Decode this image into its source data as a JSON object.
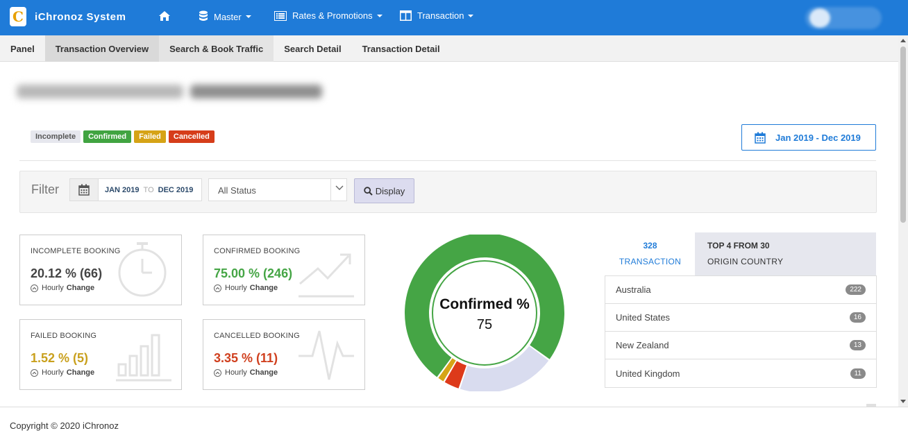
{
  "app": {
    "name": "iChronoz System",
    "logo_letter": "C"
  },
  "nav": {
    "items": [
      {
        "label": "Master",
        "icon": "database-icon"
      },
      {
        "label": "Rates & Promotions",
        "icon": "list-icon"
      },
      {
        "label": "Transaction",
        "icon": "columns-icon"
      }
    ]
  },
  "subnav": {
    "tabs": [
      {
        "label": "Panel"
      },
      {
        "label": "Transaction Overview"
      },
      {
        "label": "Search & Book Traffic"
      },
      {
        "label": "Search Detail"
      },
      {
        "label": "Transaction Detail"
      }
    ]
  },
  "legend": {
    "incomplete": "Incomplete",
    "confirmed": "Confirmed",
    "failed": "Failed",
    "cancelled": "Cancelled"
  },
  "date_range": "Jan 2019 - Dec 2019",
  "filter": {
    "label": "Filter",
    "from": "JAN 2019",
    "to_word": "TO",
    "to": "DEC 2019",
    "status": "All Status",
    "button": "Display"
  },
  "cards": {
    "incomplete": {
      "title": "INCOMPLETE BOOKING",
      "value": "20.12 % (66)",
      "change_prefix": "Hourly",
      "change_word": "Change"
    },
    "confirmed": {
      "title": "CONFIRMED BOOKING",
      "value": "75.00 % (246)",
      "change_prefix": "Hourly",
      "change_word": "Change"
    },
    "failed": {
      "title": "FAILED BOOKING",
      "value": "1.52 % (5)",
      "change_prefix": "Hourly",
      "change_word": "Change"
    },
    "cancelled": {
      "title": "CANCELLED BOOKING",
      "value": "3.35 % (11)",
      "change_prefix": "Hourly",
      "change_word": "Change"
    }
  },
  "donut": {
    "center_title": "Confirmed %",
    "center_value": "75",
    "segments": [
      {
        "name": "Confirmed",
        "percent": 75.0,
        "color": "#45a545"
      },
      {
        "name": "Incomplete",
        "percent": 20.12,
        "color": "#d9dcef"
      },
      {
        "name": "Cancelled",
        "percent": 3.35,
        "color": "#dd3a1a"
      },
      {
        "name": "Failed",
        "percent": 1.52,
        "color": "#d5a516"
      }
    ]
  },
  "transactions": {
    "count": "328",
    "label": "TRANSACTION"
  },
  "top_countries": {
    "title": "TOP 4 FROM 30",
    "subtitle": "ORIGIN COUNTRY",
    "rows": [
      {
        "country": "Australia",
        "count": "222"
      },
      {
        "country": "United States",
        "count": "16"
      },
      {
        "country": "New Zealand",
        "count": "13"
      },
      {
        "country": "United Kingdom",
        "count": "11"
      }
    ]
  },
  "footer": {
    "copyright": "Copyright © 2020 iChronoz"
  },
  "colors": {
    "primary": "#1f7bd8",
    "confirmed": "#41a441",
    "failed": "#d6a316",
    "cancelled": "#d63d1a",
    "incomplete": "#e6e7ee"
  }
}
